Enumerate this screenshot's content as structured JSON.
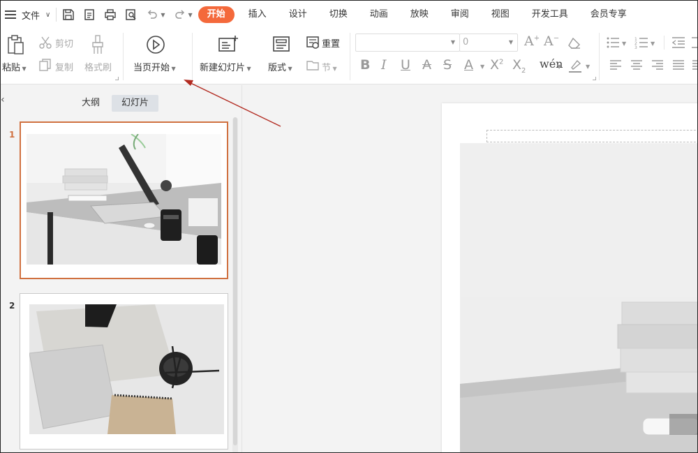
{
  "menubar": {
    "file_label": "文件",
    "tabs": [
      {
        "label": "开始",
        "active": true
      },
      {
        "label": "插入"
      },
      {
        "label": "设计"
      },
      {
        "label": "切换"
      },
      {
        "label": "动画"
      },
      {
        "label": "放映"
      },
      {
        "label": "审阅"
      },
      {
        "label": "视图"
      },
      {
        "label": "开发工具"
      },
      {
        "label": "会员专享"
      }
    ]
  },
  "ribbon": {
    "paste": "粘贴",
    "cut": "剪切",
    "copy": "复制",
    "format_painter": "格式刷",
    "play_current": "当页开始",
    "new_slide": "新建幻灯片",
    "layout": "版式",
    "reset": "重置",
    "section": "节",
    "font_size_value": "0"
  },
  "left_panel": {
    "tab_outline": "大纲",
    "tab_slides": "幻灯片",
    "slides": [
      {
        "number": "1",
        "selected": true
      },
      {
        "number": "2",
        "selected": false
      }
    ]
  },
  "colors": {
    "accent": "#f4693b",
    "selection_border": "#d0703f",
    "annotation_arrow": "#b22a20"
  }
}
